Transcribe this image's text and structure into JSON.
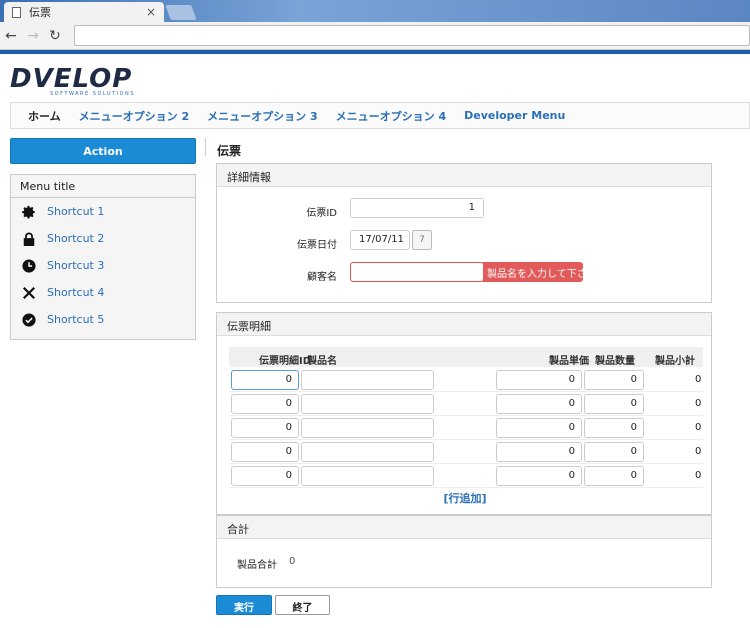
{
  "browser": {
    "tab_title": "伝票",
    "tab_close": "×",
    "back": "←",
    "forward": "→",
    "reload": "↻"
  },
  "logo": {
    "text": "DVELOP",
    "sub": "SOFTWARE SOLUTIONS"
  },
  "menu": {
    "items": [
      "ホーム",
      "メニューオプション 2",
      "メニューオプション 3",
      "メニューオプション 4",
      "Developer Menu"
    ]
  },
  "sidebar": {
    "action_label": "Action",
    "menu_title": "Menu title",
    "shortcuts": [
      {
        "label": "Shortcut 1",
        "icon": "gear-icon"
      },
      {
        "label": "Shortcut 2",
        "icon": "lock-icon"
      },
      {
        "label": "Shortcut 3",
        "icon": "clock-icon"
      },
      {
        "label": "Shortcut 4",
        "icon": "close-icon"
      },
      {
        "label": "Shortcut 5",
        "icon": "check-circle-icon"
      }
    ]
  },
  "page": {
    "title": "伝票"
  },
  "details": {
    "header": "詳細情報",
    "slip_id_label": "伝票ID",
    "slip_id_value": "1",
    "slip_date_label": "伝票日付",
    "slip_date_value": "17/07/11",
    "calendar_glyph": "7",
    "customer_label": "顧客名",
    "customer_value": "",
    "customer_error": "製品名を入力して下さい"
  },
  "lines": {
    "header": "伝票明細",
    "columns": [
      "伝票明細ID",
      "製品名",
      "製品単価",
      "製品数量",
      "製品小計"
    ],
    "rows": [
      {
        "id": "0",
        "name": "",
        "price": "0",
        "qty": "0",
        "subtotal": "0"
      },
      {
        "id": "0",
        "name": "",
        "price": "0",
        "qty": "0",
        "subtotal": "0"
      },
      {
        "id": "0",
        "name": "",
        "price": "0",
        "qty": "0",
        "subtotal": "0"
      },
      {
        "id": "0",
        "name": "",
        "price": "0",
        "qty": "0",
        "subtotal": "0"
      },
      {
        "id": "0",
        "name": "",
        "price": "0",
        "qty": "0",
        "subtotal": "0"
      }
    ],
    "add_row": "[行追加]"
  },
  "totals": {
    "header": "合計",
    "label": "製品合計",
    "value": "0"
  },
  "buttons": {
    "run": "実行",
    "end": "終了"
  },
  "colors": {
    "accent": "#1a8bd4",
    "link": "#2b6fb8",
    "error": "#e25a5a"
  }
}
